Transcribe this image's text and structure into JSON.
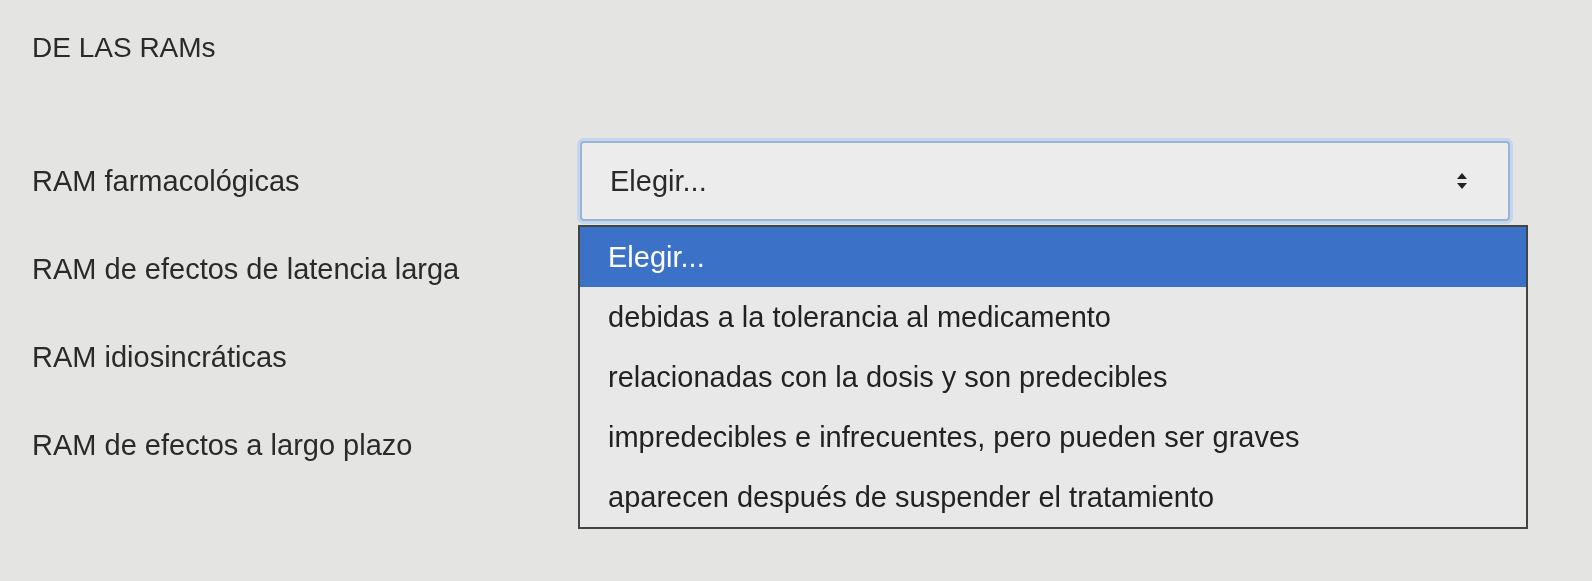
{
  "heading": "DE LAS RAMs",
  "rows": [
    {
      "label": "RAM farmacológicas"
    },
    {
      "label": "RAM de efectos de latencia larga"
    },
    {
      "label": "RAM idiosincráticas"
    },
    {
      "label": "RAM de efectos a largo plazo"
    }
  ],
  "select": {
    "value": "Elegir...",
    "expanded": true,
    "options": [
      {
        "label": "Elegir...",
        "selected": true
      },
      {
        "label": "debidas a la tolerancia al medicamento",
        "selected": false
      },
      {
        "label": "relacionadas con la dosis y son predecibles",
        "selected": false
      },
      {
        "label": "impredecibles e infrecuentes, pero pueden ser graves",
        "selected": false
      },
      {
        "label": "aparecen después de suspender el tratamiento",
        "selected": false
      }
    ]
  }
}
